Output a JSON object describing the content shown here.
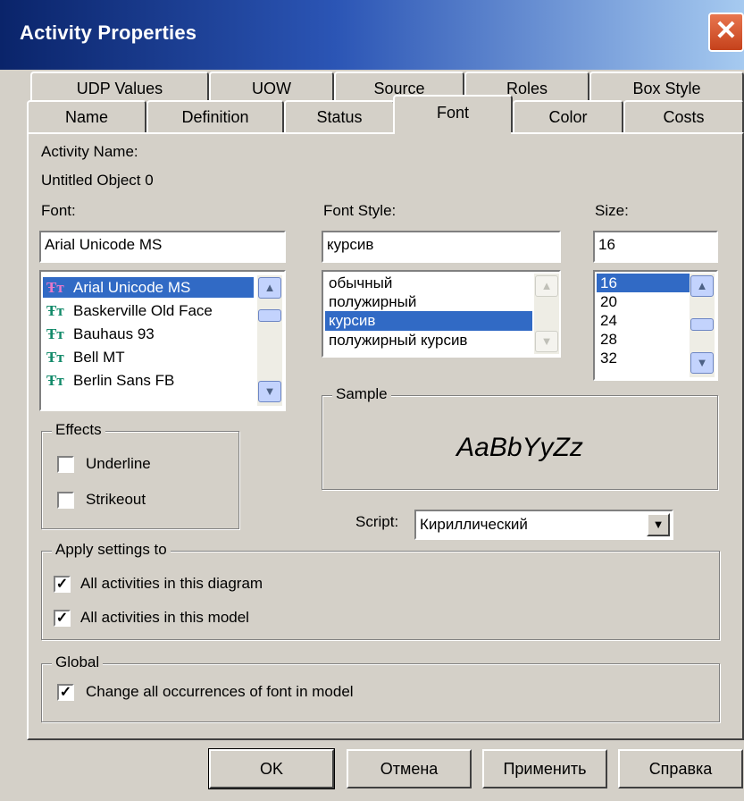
{
  "window": {
    "title": "Activity Properties"
  },
  "tabs_back": [
    "UDP Values",
    "UOW",
    "Source",
    "Roles",
    "Box Style"
  ],
  "tabs_front": [
    "Name",
    "Definition",
    "Status",
    "Font",
    "Color",
    "Costs"
  ],
  "active_tab": "Font",
  "activity": {
    "name_label": "Activity Name:",
    "name_value": "Untitled Object 0"
  },
  "font": {
    "label": "Font:",
    "value": "Arial Unicode MS",
    "items": [
      "Arial Unicode MS",
      "Baskerville Old Face",
      "Bauhaus 93",
      "Bell MT",
      "Berlin Sans FB"
    ],
    "selected": "Arial Unicode MS",
    "icon": "truetype-font-icon"
  },
  "font_style": {
    "label": "Font Style:",
    "value": "курсив",
    "items": [
      "обычный",
      "полужирный",
      "курсив",
      "полужирный курсив"
    ],
    "selected": "курсив"
  },
  "size": {
    "label": "Size:",
    "value": "16",
    "items": [
      "16",
      "20",
      "24",
      "28",
      "32"
    ],
    "selected": "16"
  },
  "sample": {
    "label": "Sample",
    "text": "AaBbYyZz"
  },
  "effects": {
    "label": "Effects",
    "underline": {
      "label": "Underline",
      "checked": false
    },
    "strikeout": {
      "label": "Strikeout",
      "checked": false
    }
  },
  "script": {
    "label": "Script:",
    "value": "Кириллический"
  },
  "apply": {
    "label": "Apply settings to",
    "diagram": {
      "label": "All activities in this diagram",
      "checked": true
    },
    "model": {
      "label": "All activities in this model",
      "checked": true
    }
  },
  "global": {
    "label": "Global",
    "change": {
      "label": "Change all occurrences of font in model",
      "checked": true
    }
  },
  "buttons": {
    "ok": "OK",
    "cancel": "Отмена",
    "apply": "Применить",
    "help": "Справка"
  },
  "colors": {
    "selection": "#316ac5",
    "titlebar": "#0a246a",
    "dialog": "#d4d0c8"
  }
}
